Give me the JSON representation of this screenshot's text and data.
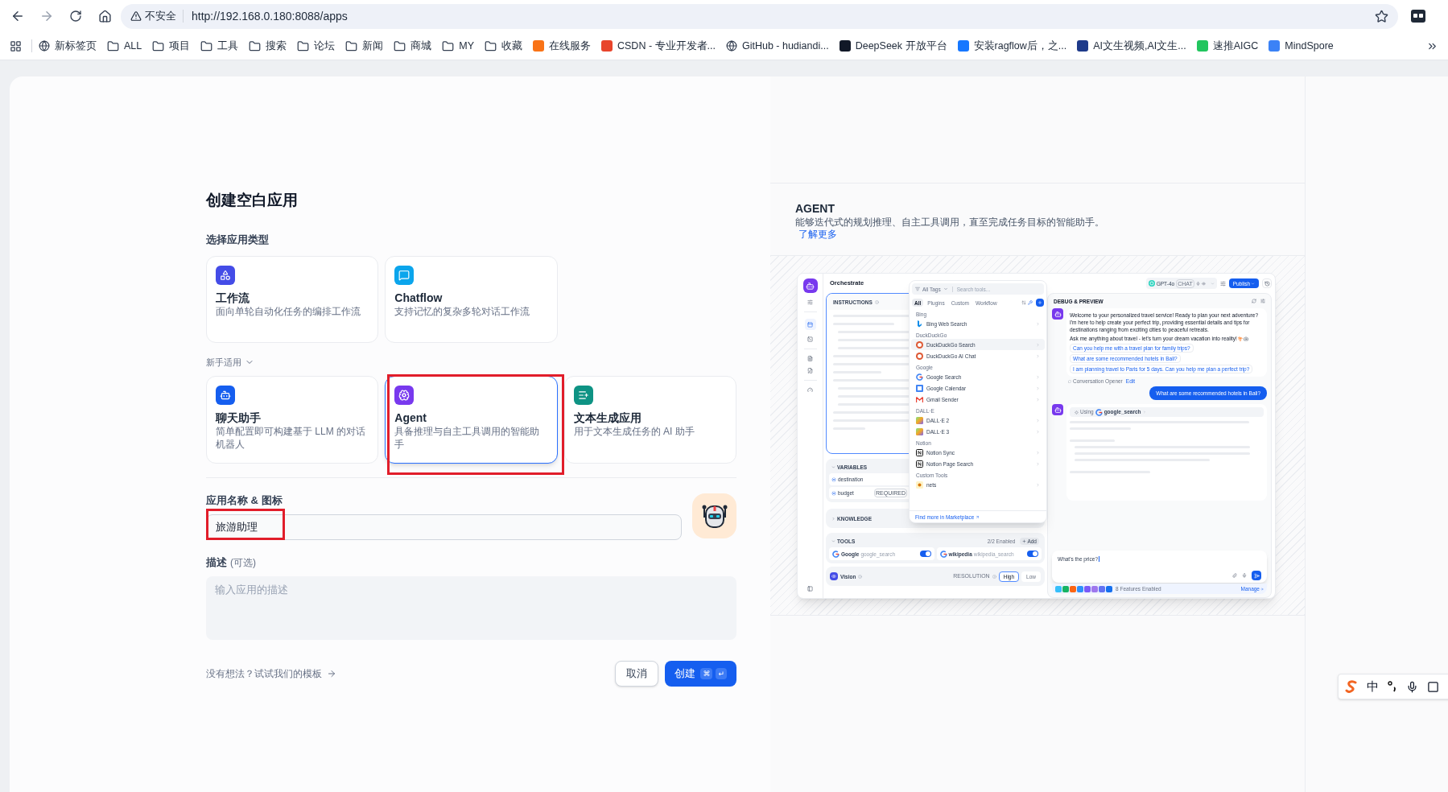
{
  "browser": {
    "security": "不安全",
    "url": "http://192.168.0.180:8088/apps",
    "bookmarks": [
      {
        "label": "新标签页",
        "kind": "globe"
      },
      {
        "label": "ALL",
        "kind": "folder"
      },
      {
        "label": "项目",
        "kind": "folder"
      },
      {
        "label": "工具",
        "kind": "folder"
      },
      {
        "label": "搜索",
        "kind": "folder"
      },
      {
        "label": "论坛",
        "kind": "folder"
      },
      {
        "label": "新闻",
        "kind": "folder"
      },
      {
        "label": "商城",
        "kind": "folder"
      },
      {
        "label": "MY",
        "kind": "folder"
      },
      {
        "label": "收藏",
        "kind": "folder"
      },
      {
        "label": "在线服务",
        "kind": "site",
        "color": "#f97316"
      },
      {
        "label": "CSDN - 专业开发者...",
        "kind": "site",
        "color": "#e8452c"
      },
      {
        "label": "GitHub - hudiandi...",
        "kind": "globe"
      },
      {
        "label": "DeepSeek 开放平台",
        "kind": "site",
        "color": "#111827"
      },
      {
        "label": "安装ragflow后，之...",
        "kind": "site",
        "color": "#1677ff"
      },
      {
        "label": "AI文生视频,AI文生...",
        "kind": "site",
        "color": "#1e3a8a"
      },
      {
        "label": "速推AIGC",
        "kind": "site",
        "color": "#22c55e"
      },
      {
        "label": "MindSpore",
        "kind": "site",
        "color": "#3b82f6"
      }
    ]
  },
  "form": {
    "title": "创建空白应用",
    "type_label": "选择应用类型",
    "app_types": [
      {
        "kind": "workflow",
        "title": "工作流",
        "description": "面向单轮自动化任务的编排工作流",
        "color": "#444ce7",
        "selected": false,
        "annotated": false
      },
      {
        "kind": "chatflow",
        "title": "Chatflow",
        "description": "支持记忆的复杂多轮对话工作流",
        "color": "#0ba5ec",
        "selected": false,
        "annotated": false
      }
    ],
    "beginner_label": "新手适用",
    "beginner_expanded": true,
    "beginner_types": [
      {
        "kind": "chatbot",
        "title": "聊天助手",
        "description": "简单配置即可构建基于 LLM 的对话机器人",
        "color": "#155eef",
        "selected": false,
        "annotated": false
      },
      {
        "kind": "agent",
        "title": "Agent",
        "description": "具备推理与自主工具调用的智能助手",
        "color": "#7839ee",
        "selected": true,
        "annotated": true
      },
      {
        "kind": "completion",
        "title": "文本生成应用",
        "description": "用于文本生成任务的 AI 助手",
        "color": "#0e9384",
        "selected": false,
        "annotated": false
      }
    ],
    "name_label": "应用名称 & 图标",
    "name_value": "旅游助理",
    "name_annotated": true,
    "description_label": "描述",
    "description_optional": "(可选)",
    "description_placeholder": "输入应用的描述",
    "template_link": "没有想法？试试我们的模板",
    "cancel": "取消",
    "create": "创建",
    "create_keys": [
      "⌘",
      "↵"
    ]
  },
  "info": {
    "title": "AGENT",
    "description": "能够迭代式的规划推理、自主工具调用，直至完成任务目标的智能助手。",
    "link": "了解更多"
  },
  "preview": {
    "title": "Orchestrate",
    "instructions_label": "INSTRUCTIONS",
    "variables_label": "VARIABLES",
    "variables": [
      {
        "name": "destination"
      },
      {
        "name": "budget",
        "badge": "REQUIRED"
      }
    ],
    "knowledge_label": "KNOWLEDGE",
    "tools_label": "TOOLS",
    "tools_count": "2/2 Enabled",
    "add_button": "Add",
    "tools": [
      {
        "name": "Google",
        "id": "google_search",
        "on": true
      },
      {
        "name": "wikipedia",
        "id": "wikipedia_search",
        "on": true
      }
    ],
    "vision_label": "Vision",
    "resolution_label": "RESOLUTION",
    "resolutions": [
      {
        "label": "High",
        "selected": true
      },
      {
        "label": "Low",
        "selected": false
      }
    ],
    "picker": {
      "tags": "All Tags",
      "search_placeholder": "Search tools...",
      "tabs": [
        {
          "label": "All",
          "selected": true
        },
        {
          "label": "Plugins",
          "selected": false
        },
        {
          "label": "Custom",
          "selected": false
        },
        {
          "label": "Workflow",
          "selected": false
        }
      ],
      "groups": [
        {
          "name": "Bing",
          "items": [
            {
              "label": "Bing Web Search",
              "kind": "bing",
              "selected": false
            }
          ]
        },
        {
          "name": "DuckDuckGo",
          "items": [
            {
              "label": "DuckDuckGo Search",
              "kind": "duck",
              "selected": true
            },
            {
              "label": "DuckDuckGo AI Chat",
              "kind": "duck",
              "selected": false
            }
          ]
        },
        {
          "name": "Google",
          "items": [
            {
              "label": "Google Search",
              "kind": "google",
              "selected": false
            },
            {
              "label": "Google Calendar",
              "kind": "calendar",
              "selected": false
            },
            {
              "label": "Gmail Sender",
              "kind": "mail",
              "selected": false
            }
          ]
        },
        {
          "name": "DALL·E",
          "items": [
            {
              "label": "DALL·E 2",
              "kind": "gradient",
              "selected": false
            },
            {
              "label": "DALL·E 3",
              "kind": "gradient",
              "selected": false
            }
          ]
        },
        {
          "name": "Notion",
          "items": [
            {
              "label": "Notion Sync",
              "kind": "notion",
              "selected": false
            },
            {
              "label": "Notion Page Search",
              "kind": "notion",
              "selected": false
            }
          ]
        },
        {
          "name": "Custom Tools",
          "items": [
            {
              "label": "nets",
              "kind": "custom",
              "selected": false
            }
          ]
        }
      ],
      "marketplace": "Find more in Marketplace"
    },
    "model": "GPT-4o",
    "model_badge": "CHAT",
    "publish": "Publish",
    "debug_title": "DEBUG & PREVIEW",
    "welcome": [
      "Welcome to your personalized travel service! Ready to plan your next adventure? I'm here to help create your perfect trip, providing essential details and tips for destinations ranging from exciting cities to peaceful retreats.",
      "Ask me anything about travel - let's turn your dream vacation into reality!"
    ],
    "suggestions": [
      "Can you help me with a travel plan for family trips?",
      "What are some recommended hotels in Bali?",
      "I am planning travel to Paris for 5 days. Can you help me plan a perfect trip?"
    ],
    "opener_label": "Conversation Opener",
    "edit": "Edit",
    "user_message": "What are some recommended hotels in Bali?",
    "using": "Using",
    "using_tool": "google_search",
    "input_value": "What's the price?",
    "features": "8 Features Enabled",
    "manage": "Manage"
  },
  "ime": {
    "mode": "中"
  }
}
